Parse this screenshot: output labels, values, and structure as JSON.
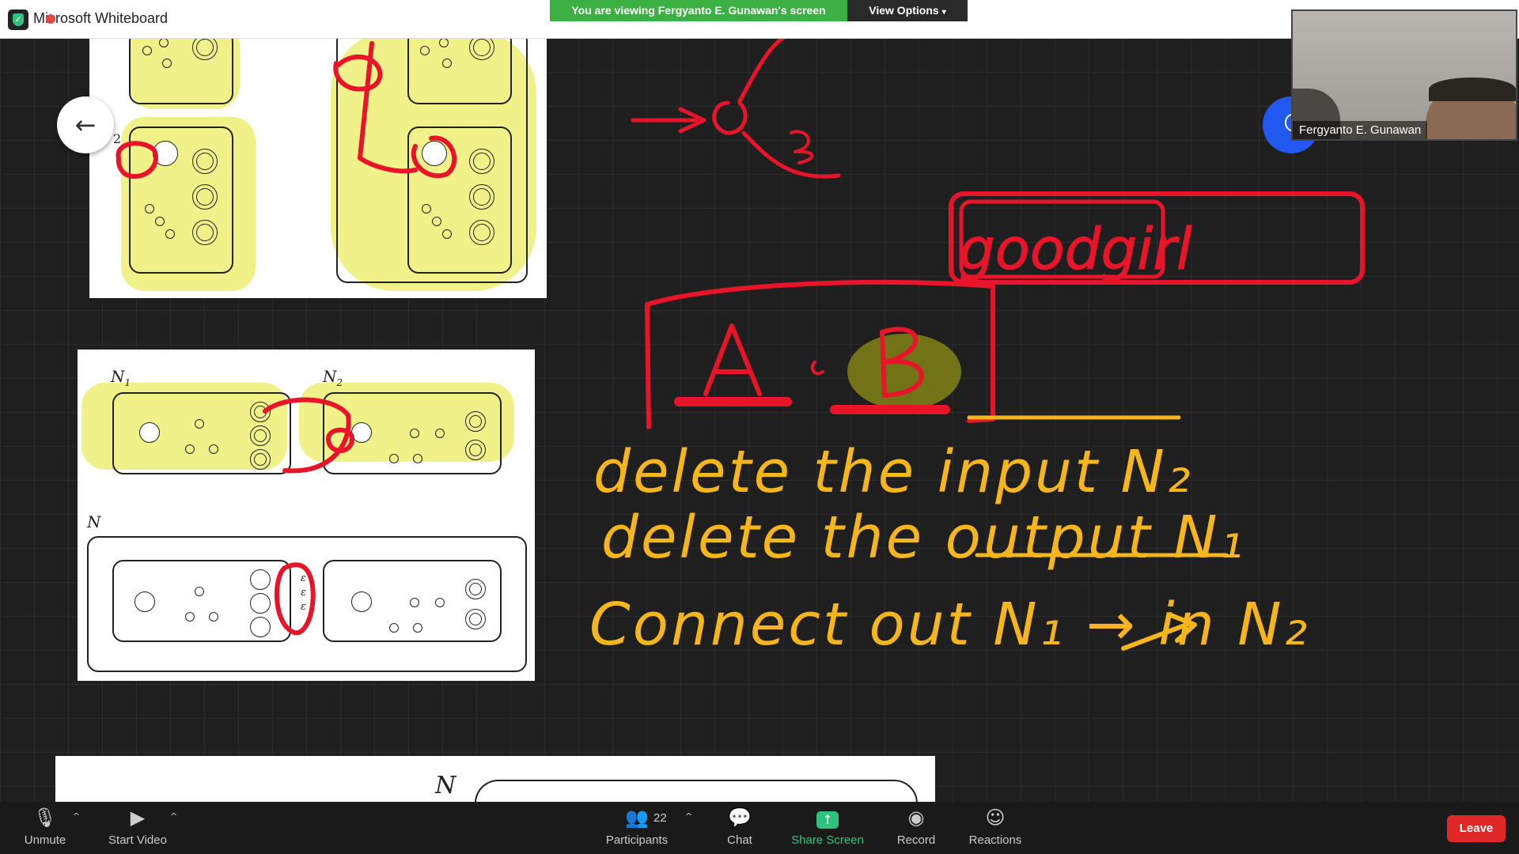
{
  "window": {
    "title": "Microsoft Whiteboard"
  },
  "share_banner": {
    "text": "You are viewing Fergyanto  E. Gunawan's screen",
    "view_options": "View Options"
  },
  "speaker": {
    "name": "Fergyanto  E. Gunawan"
  },
  "diagram": {
    "label_2": "2",
    "label_n1": "N",
    "label_n1_sub": "1",
    "label_n2": "N",
    "label_n2_sub": "2",
    "label_n": "N",
    "label_n_bottom": "N",
    "epsilon": "ε"
  },
  "handwriting": {
    "line1": "delete the input N₂",
    "line2": "delete the output N₁",
    "line3": "Connect out N₁ → in N₂",
    "tag": "goodgirl",
    "letters": "A ∘ B",
    "epsilon_top": "ε"
  },
  "toolbar": {
    "unmute": "Unmute",
    "start_video": "Start Video",
    "participants": "Participants",
    "participants_count": "22",
    "chat": "Chat",
    "share_screen": "Share Screen",
    "record": "Record",
    "reactions": "Reactions",
    "leave": "Leave"
  },
  "colors": {
    "ink_red": "#e8142a",
    "ink_yellow": "#f5b51c",
    "highlight": "#e6e628",
    "share_green": "#3cb043",
    "leave_red": "#e02828"
  }
}
